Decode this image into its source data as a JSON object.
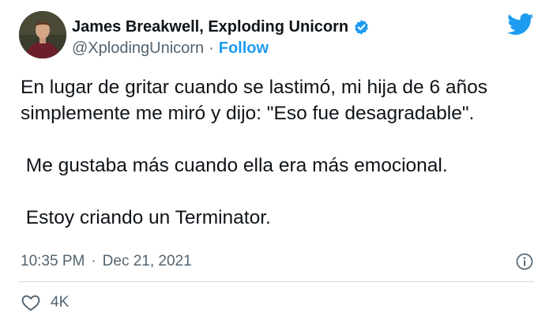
{
  "author": {
    "display_name": "James Breakwell, Exploding Unicorn",
    "handle": "@XplodingUnicorn",
    "separator": "·",
    "follow_label": "Follow",
    "verified": true
  },
  "tweet": {
    "paragraphs": [
      "En lugar de gritar cuando se lastimó, mi hija de 6 años simplemente me miró y dijo: \"Eso fue desagradable\".",
      " Me gustaba más cuando ella era más emocional.",
      " Estoy criando un Terminator."
    ],
    "time": "10:35 PM",
    "date_separator": "·",
    "date": "Dec 21, 2021",
    "likes": "4K"
  },
  "icons": {
    "verified": "verified-badge-icon",
    "brand": "twitter-bird-icon",
    "info": "info-icon",
    "like": "heart-icon"
  },
  "colors": {
    "accent": "#1d9bf0",
    "text": "#0f1419",
    "muted": "#536471",
    "divider": "#cfd9de"
  }
}
